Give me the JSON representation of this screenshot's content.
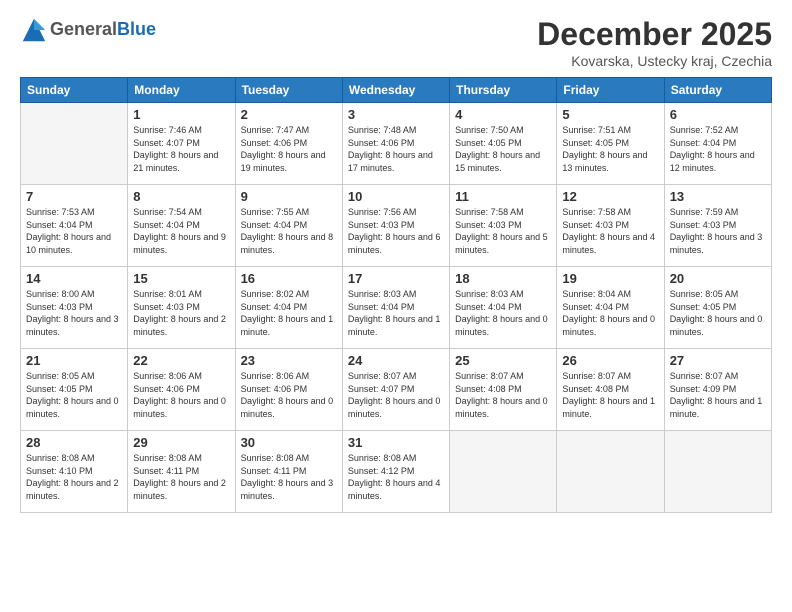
{
  "logo": {
    "general": "General",
    "blue": "Blue"
  },
  "header": {
    "title": "December 2025",
    "location": "Kovarska, Ustecky kraj, Czechia"
  },
  "weekdays": [
    "Sunday",
    "Monday",
    "Tuesday",
    "Wednesday",
    "Thursday",
    "Friday",
    "Saturday"
  ],
  "weeks": [
    [
      {
        "day": null,
        "sunrise": "",
        "sunset": "",
        "daylight": ""
      },
      {
        "day": "1",
        "sunrise": "7:46 AM",
        "sunset": "4:07 PM",
        "daylight": "8 hours and 21 minutes."
      },
      {
        "day": "2",
        "sunrise": "7:47 AM",
        "sunset": "4:06 PM",
        "daylight": "8 hours and 19 minutes."
      },
      {
        "day": "3",
        "sunrise": "7:48 AM",
        "sunset": "4:06 PM",
        "daylight": "8 hours and 17 minutes."
      },
      {
        "day": "4",
        "sunrise": "7:50 AM",
        "sunset": "4:05 PM",
        "daylight": "8 hours and 15 minutes."
      },
      {
        "day": "5",
        "sunrise": "7:51 AM",
        "sunset": "4:05 PM",
        "daylight": "8 hours and 13 minutes."
      },
      {
        "day": "6",
        "sunrise": "7:52 AM",
        "sunset": "4:04 PM",
        "daylight": "8 hours and 12 minutes."
      }
    ],
    [
      {
        "day": "7",
        "sunrise": "7:53 AM",
        "sunset": "4:04 PM",
        "daylight": "8 hours and 10 minutes."
      },
      {
        "day": "8",
        "sunrise": "7:54 AM",
        "sunset": "4:04 PM",
        "daylight": "8 hours and 9 minutes."
      },
      {
        "day": "9",
        "sunrise": "7:55 AM",
        "sunset": "4:04 PM",
        "daylight": "8 hours and 8 minutes."
      },
      {
        "day": "10",
        "sunrise": "7:56 AM",
        "sunset": "4:03 PM",
        "daylight": "8 hours and 6 minutes."
      },
      {
        "day": "11",
        "sunrise": "7:58 AM",
        "sunset": "4:03 PM",
        "daylight": "8 hours and 5 minutes."
      },
      {
        "day": "12",
        "sunrise": "7:58 AM",
        "sunset": "4:03 PM",
        "daylight": "8 hours and 4 minutes."
      },
      {
        "day": "13",
        "sunrise": "7:59 AM",
        "sunset": "4:03 PM",
        "daylight": "8 hours and 3 minutes."
      }
    ],
    [
      {
        "day": "14",
        "sunrise": "8:00 AM",
        "sunset": "4:03 PM",
        "daylight": "8 hours and 3 minutes."
      },
      {
        "day": "15",
        "sunrise": "8:01 AM",
        "sunset": "4:03 PM",
        "daylight": "8 hours and 2 minutes."
      },
      {
        "day": "16",
        "sunrise": "8:02 AM",
        "sunset": "4:04 PM",
        "daylight": "8 hours and 1 minute."
      },
      {
        "day": "17",
        "sunrise": "8:03 AM",
        "sunset": "4:04 PM",
        "daylight": "8 hours and 1 minute."
      },
      {
        "day": "18",
        "sunrise": "8:03 AM",
        "sunset": "4:04 PM",
        "daylight": "8 hours and 0 minutes."
      },
      {
        "day": "19",
        "sunrise": "8:04 AM",
        "sunset": "4:04 PM",
        "daylight": "8 hours and 0 minutes."
      },
      {
        "day": "20",
        "sunrise": "8:05 AM",
        "sunset": "4:05 PM",
        "daylight": "8 hours and 0 minutes."
      }
    ],
    [
      {
        "day": "21",
        "sunrise": "8:05 AM",
        "sunset": "4:05 PM",
        "daylight": "8 hours and 0 minutes."
      },
      {
        "day": "22",
        "sunrise": "8:06 AM",
        "sunset": "4:06 PM",
        "daylight": "8 hours and 0 minutes."
      },
      {
        "day": "23",
        "sunrise": "8:06 AM",
        "sunset": "4:06 PM",
        "daylight": "8 hours and 0 minutes."
      },
      {
        "day": "24",
        "sunrise": "8:07 AM",
        "sunset": "4:07 PM",
        "daylight": "8 hours and 0 minutes."
      },
      {
        "day": "25",
        "sunrise": "8:07 AM",
        "sunset": "4:08 PM",
        "daylight": "8 hours and 0 minutes."
      },
      {
        "day": "26",
        "sunrise": "8:07 AM",
        "sunset": "4:08 PM",
        "daylight": "8 hours and 1 minute."
      },
      {
        "day": "27",
        "sunrise": "8:07 AM",
        "sunset": "4:09 PM",
        "daylight": "8 hours and 1 minute."
      }
    ],
    [
      {
        "day": "28",
        "sunrise": "8:08 AM",
        "sunset": "4:10 PM",
        "daylight": "8 hours and 2 minutes."
      },
      {
        "day": "29",
        "sunrise": "8:08 AM",
        "sunset": "4:11 PM",
        "daylight": "8 hours and 2 minutes."
      },
      {
        "day": "30",
        "sunrise": "8:08 AM",
        "sunset": "4:11 PM",
        "daylight": "8 hours and 3 minutes."
      },
      {
        "day": "31",
        "sunrise": "8:08 AM",
        "sunset": "4:12 PM",
        "daylight": "8 hours and 4 minutes."
      },
      {
        "day": null,
        "sunrise": "",
        "sunset": "",
        "daylight": ""
      },
      {
        "day": null,
        "sunrise": "",
        "sunset": "",
        "daylight": ""
      },
      {
        "day": null,
        "sunrise": "",
        "sunset": "",
        "daylight": ""
      }
    ]
  ]
}
